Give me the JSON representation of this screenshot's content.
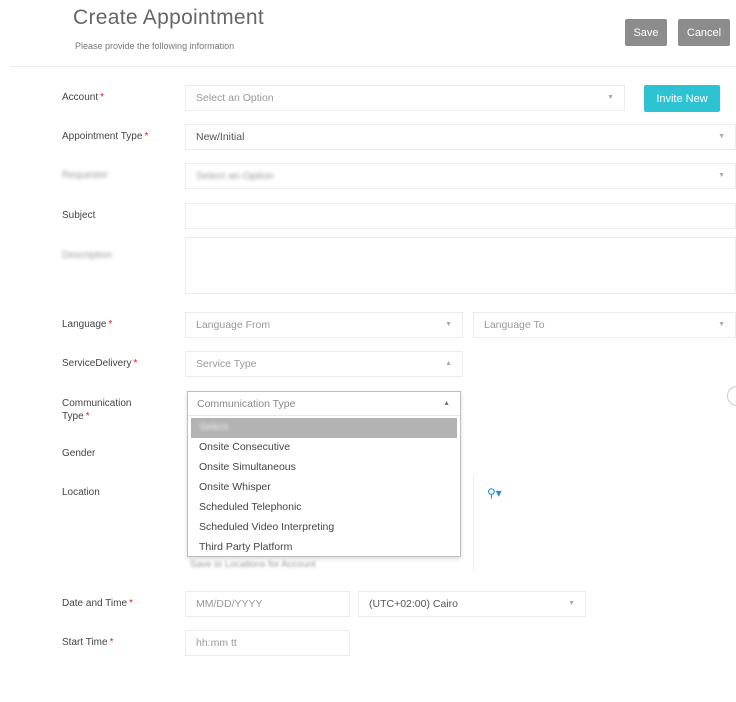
{
  "header": {
    "title": "Create Appointment",
    "subtitle": "Please provide the following information",
    "save_label": "Save",
    "cancel_label": "Cancel"
  },
  "form": {
    "account": {
      "label": "Account",
      "placeholder": "Select an Option",
      "invite_label": "Invite New"
    },
    "appointment_type": {
      "label": "Appointment Type",
      "value": "New/Initial"
    },
    "requester": {
      "label": "Requester",
      "placeholder": "Select an Option"
    },
    "subject": {
      "label": "Subject"
    },
    "description": {
      "label": "Description"
    },
    "language": {
      "label": "Language",
      "from_placeholder": "Language From",
      "to_placeholder": "Language To"
    },
    "service_delivery": {
      "label": "ServiceDelivery",
      "placeholder": "Service Type"
    },
    "communication_type": {
      "label_line1": "Communication",
      "label_line2": "Type",
      "placeholder": "Communication Type",
      "options": [
        "Onsite Consecutive",
        "Onsite Simultaneous",
        "Onsite Whisper",
        "Scheduled Telephonic",
        "Scheduled Video Interpreting",
        "Third Party Platform"
      ],
      "selected_option": "Select"
    },
    "gender": {
      "label": "Gender"
    },
    "location": {
      "label": "Location",
      "save_hint": "Save to Locations for Account"
    },
    "date_time": {
      "label": "Date and Time",
      "date_placeholder": "MM/DD/YYYY",
      "timezone": "(UTC+02:00) Cairo"
    },
    "start_time": {
      "label": "Start Time",
      "placeholder": "hh:mm tt"
    },
    "required_mark": "*"
  },
  "colors": {
    "accent": "#2ec3d2",
    "required": "#d9232d",
    "button_gray": "#8c8c8c",
    "map_icon": "#2a8fd6"
  }
}
